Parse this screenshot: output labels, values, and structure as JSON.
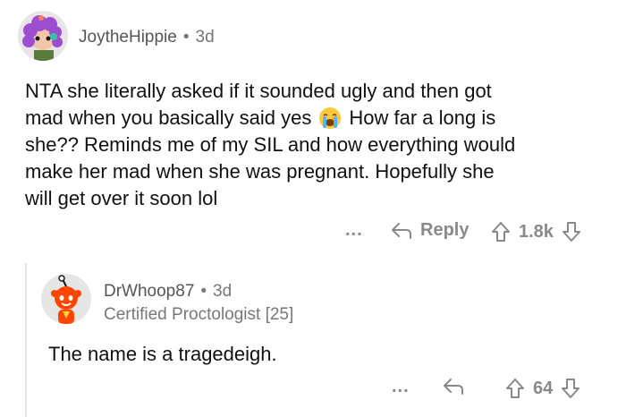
{
  "comment1": {
    "username": "JoytheHippie",
    "separator": "•",
    "age": "3d",
    "body_lines": [
      "NTA she literally asked if it sounded ugly and then got",
      "mad when you basically said yes",
      "How far a long is",
      "she?? Reminds me of my SIL and how everything would",
      "make her mad when she was pregnant. Hopefully she",
      "will get over it soon lol"
    ],
    "more": "...",
    "reply_label": "Reply",
    "score": "1.8k"
  },
  "comment2": {
    "username": "DrWhoop87",
    "separator": "•",
    "age": "3d",
    "flair": "Certified Proctologist [25]",
    "body": "The name is a tragedeigh.",
    "more": "...",
    "score": "64"
  },
  "colors": {
    "avatar1_bg": "#e9e3ea",
    "hair": "#9b4fd0",
    "avatar2_bg": "#e6e6e6",
    "snoo_orange": "#ff4500",
    "action_gray": "#878a8c"
  }
}
